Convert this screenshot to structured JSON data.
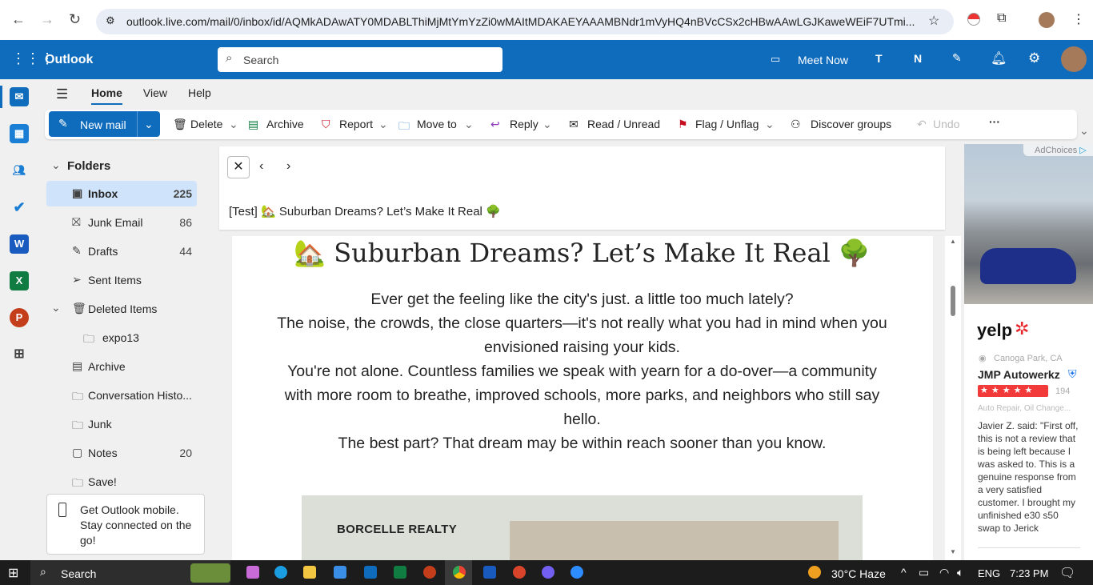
{
  "browser": {
    "url": "outlook.live.com/mail/0/inbox/id/AQMkADAwATY0MDABLThiMjMtYmYzZi0wMAItMDAKAEYAAAMBNdr1mVyHQ4nBVcCSx2cHBwAAwLGJKaweWEiF7UTmi..."
  },
  "header": {
    "app": "Outlook",
    "search_placeholder": "Search",
    "meet_now": "Meet Now"
  },
  "tabs": [
    "Home",
    "View",
    "Help"
  ],
  "ribbon": {
    "new_mail": "New mail",
    "delete": "Delete",
    "archive": "Archive",
    "report": "Report",
    "move_to": "Move to",
    "reply": "Reply",
    "read_unread": "Read / Unread",
    "flag": "Flag / Unflag",
    "discover": "Discover groups",
    "undo": "Undo",
    "more": "···"
  },
  "folders": {
    "title": "Folders",
    "items": [
      {
        "label": "Inbox",
        "count": "225"
      },
      {
        "label": "Junk Email",
        "count": "86"
      },
      {
        "label": "Drafts",
        "count": "44"
      },
      {
        "label": "Sent Items",
        "count": ""
      },
      {
        "label": "Deleted Items",
        "count": ""
      },
      {
        "label": "expo13",
        "count": ""
      },
      {
        "label": "Archive",
        "count": ""
      },
      {
        "label": "Conversation Histo...",
        "count": ""
      },
      {
        "label": "Junk",
        "count": ""
      },
      {
        "label": "Notes",
        "count": "20"
      },
      {
        "label": "Save!",
        "count": ""
      }
    ]
  },
  "mobile_promo": "Get Outlook mobile. Stay connected on the go!",
  "message": {
    "subject": "[Test] 🏡 Suburban Dreams? Let’s Make It Real 🌳",
    "heading": "🏡 Suburban Dreams? Let’s Make It Real 🌳",
    "paragraphs": [
      "Ever get the feeling like the city's just. a little too much lately?",
      "The noise, the crowds, the close quarters—it's not really what you had in mind when you envisioned raising your kids.",
      "You're not alone. Countless families we speak with yearn for a do-over—a community with more room to breathe, improved schools, more parks, and neighbors who still say hello.",
      "The best part? That dream may be within reach sooner than you know."
    ],
    "brand": "BORCELLE REALTY"
  },
  "ad": {
    "adchoices": "AdChoices",
    "logo": "yelp",
    "location": "Canoga Park, CA",
    "business": "JMP Autowerkz",
    "reviews": "194",
    "category": "Auto Repair, Oil Change...",
    "review": "Javier Z. said: \"First off, this is not a review that is being left because I was asked to. This is a genuine response from a very satisfied customer. I brought my unfinished e30 s50 swap to Jerick",
    "rating": 5
  },
  "taskbar": {
    "search": "Search",
    "weather": "30°C  Haze",
    "lang": "ENG",
    "time": "7:23 PM"
  }
}
